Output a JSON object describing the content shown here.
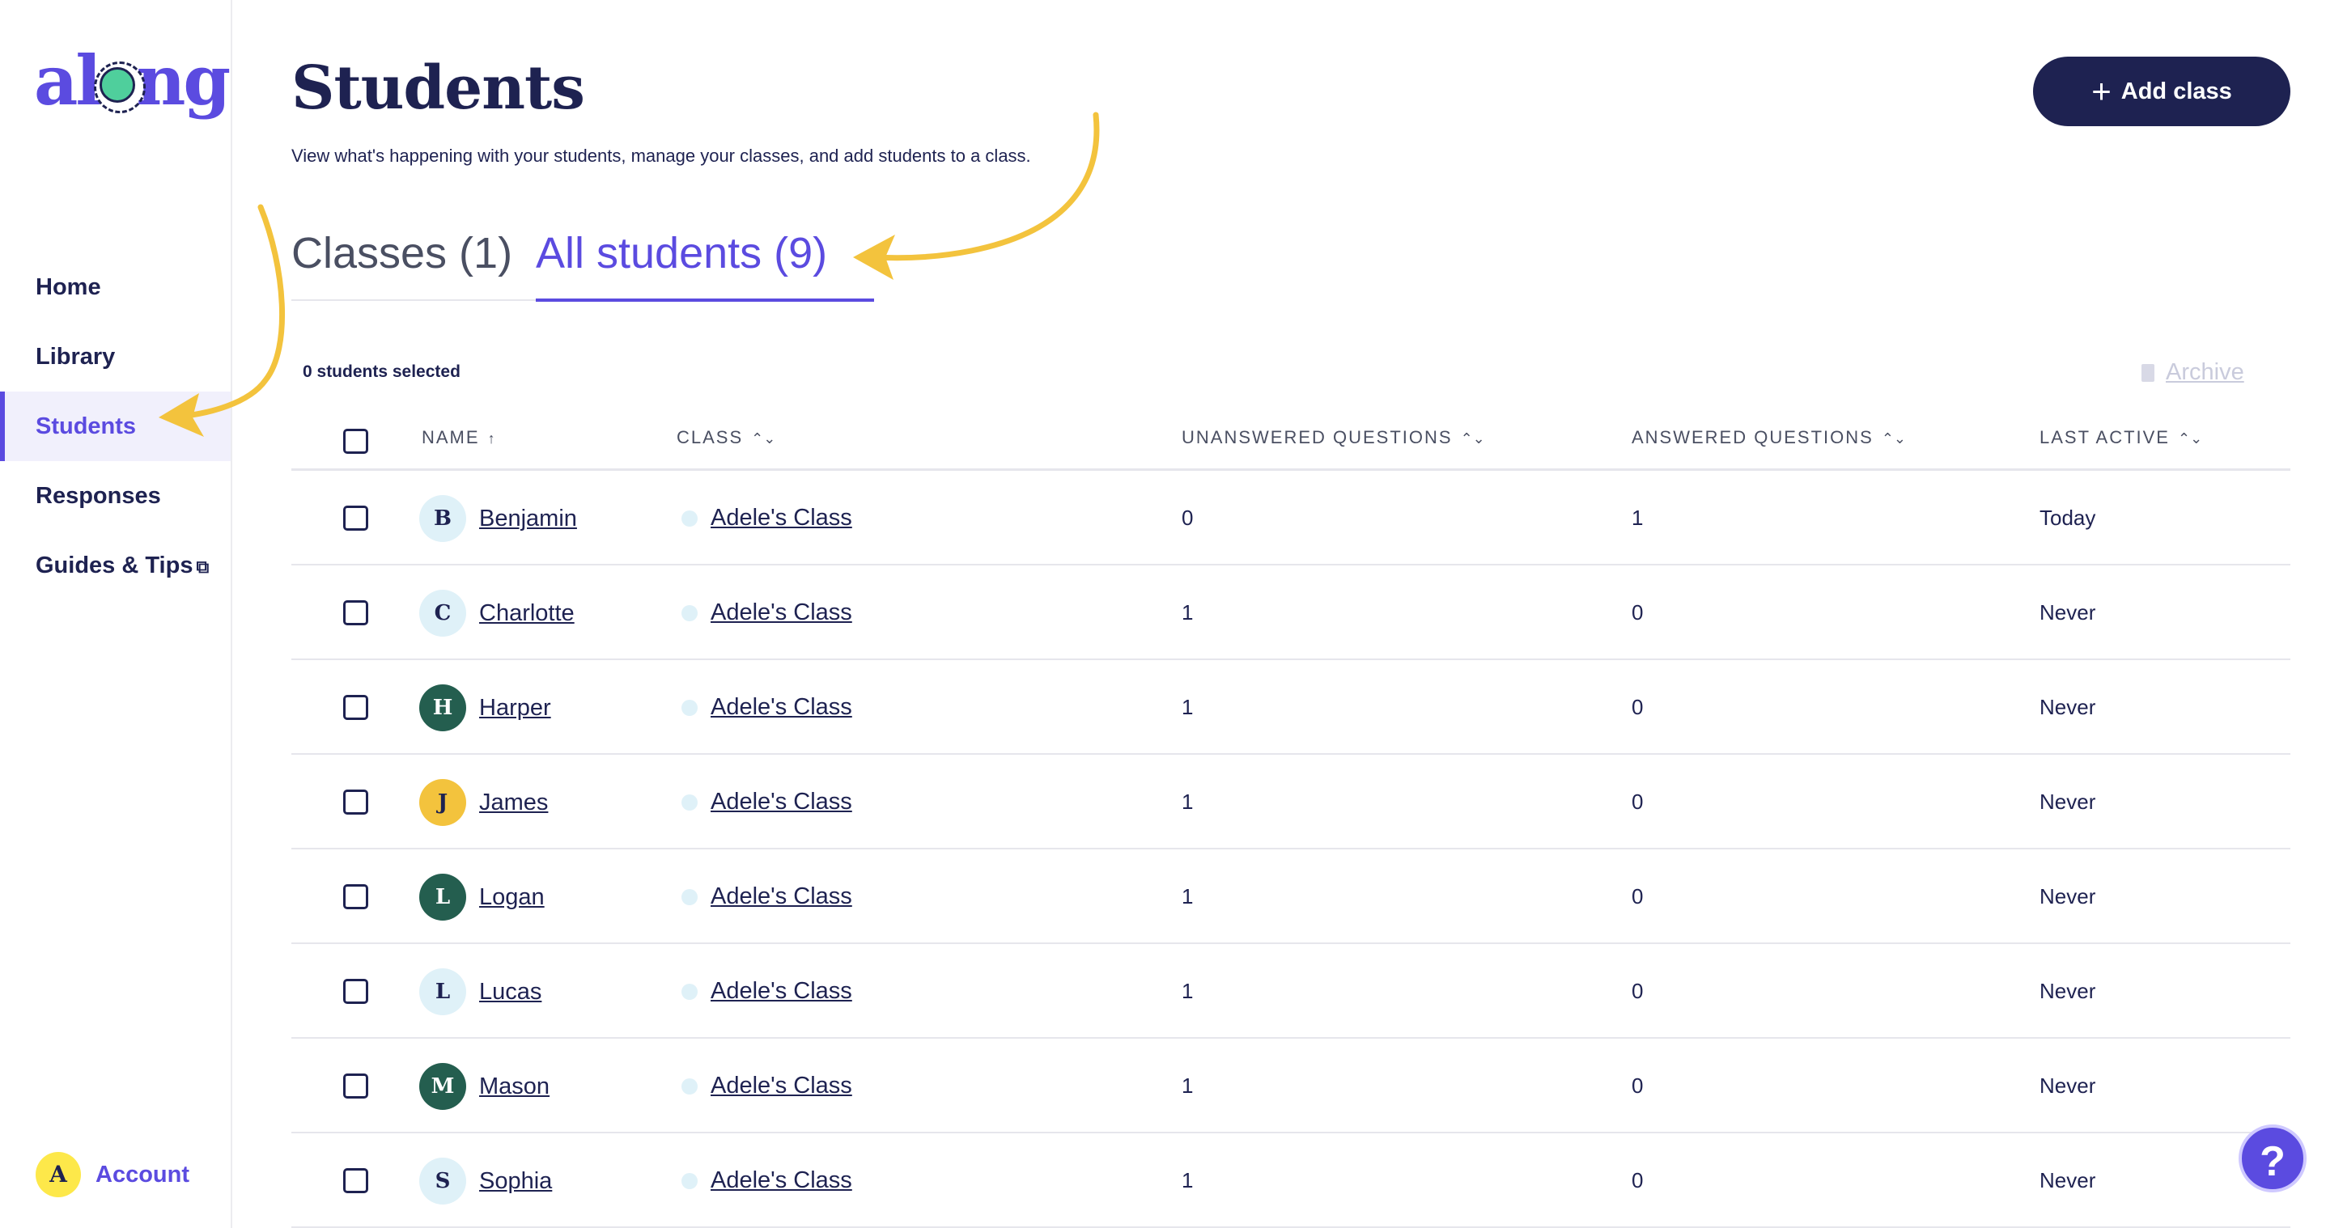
{
  "sidebar": {
    "logo_text": "along",
    "items": [
      {
        "label": "Home",
        "active": false
      },
      {
        "label": "Library",
        "active": false
      },
      {
        "label": "Students",
        "active": true
      },
      {
        "label": "Responses",
        "active": false
      },
      {
        "label": "Guides & Tips",
        "active": false,
        "external": true
      }
    ],
    "account": {
      "initial": "A",
      "label": "Account"
    }
  },
  "header": {
    "title": "Students",
    "subtitle": "View what's happening with your students, manage your classes, and add students to a class.",
    "add_button_label": "Add class"
  },
  "tabs": [
    {
      "label": "Classes (1)",
      "active": false
    },
    {
      "label": "All students (9)",
      "active": true
    }
  ],
  "toolbar": {
    "selected_text": "0 students selected",
    "archive_label": "Archive"
  },
  "table": {
    "columns": [
      "NAME",
      "CLASS",
      "UNANSWERED QUESTIONS",
      "ANSWERED QUESTIONS",
      "LAST ACTIVE"
    ],
    "sort_indicators": {
      "name": "↑",
      "other": "⌃⌄"
    },
    "rows": [
      {
        "initial": "B",
        "name": "Benjamin",
        "class": "Adele's Class",
        "unanswered": "0",
        "answered": "1",
        "last_active": "Today",
        "avatar_color": "#dff1f8",
        "avatar_text": "#1e2251"
      },
      {
        "initial": "C",
        "name": "Charlotte",
        "class": "Adele's Class",
        "unanswered": "1",
        "answered": "0",
        "last_active": "Never",
        "avatar_color": "#dff1f8",
        "avatar_text": "#1e2251"
      },
      {
        "initial": "H",
        "name": "Harper",
        "class": "Adele's Class",
        "unanswered": "1",
        "answered": "0",
        "last_active": "Never",
        "avatar_color": "#245e4f",
        "avatar_text": "#ffffff"
      },
      {
        "initial": "J",
        "name": "James",
        "class": "Adele's Class",
        "unanswered": "1",
        "answered": "0",
        "last_active": "Never",
        "avatar_color": "#f3c33d",
        "avatar_text": "#1e2251"
      },
      {
        "initial": "L",
        "name": "Logan",
        "class": "Adele's Class",
        "unanswered": "1",
        "answered": "0",
        "last_active": "Never",
        "avatar_color": "#245e4f",
        "avatar_text": "#ffffff"
      },
      {
        "initial": "L",
        "name": "Lucas",
        "class": "Adele's Class",
        "unanswered": "1",
        "answered": "0",
        "last_active": "Never",
        "avatar_color": "#dff1f8",
        "avatar_text": "#1e2251"
      },
      {
        "initial": "M",
        "name": "Mason",
        "class": "Adele's Class",
        "unanswered": "1",
        "answered": "0",
        "last_active": "Never",
        "avatar_color": "#245e4f",
        "avatar_text": "#ffffff"
      },
      {
        "initial": "S",
        "name": "Sophia",
        "class": "Adele's Class",
        "unanswered": "1",
        "answered": "0",
        "last_active": "Never",
        "avatar_color": "#dff1f8",
        "avatar_text": "#1e2251"
      }
    ]
  },
  "help_label": "?",
  "colors": {
    "accent": "#5b4be0",
    "navy": "#1e2251",
    "annotation_arrow": "#f3c33d"
  }
}
